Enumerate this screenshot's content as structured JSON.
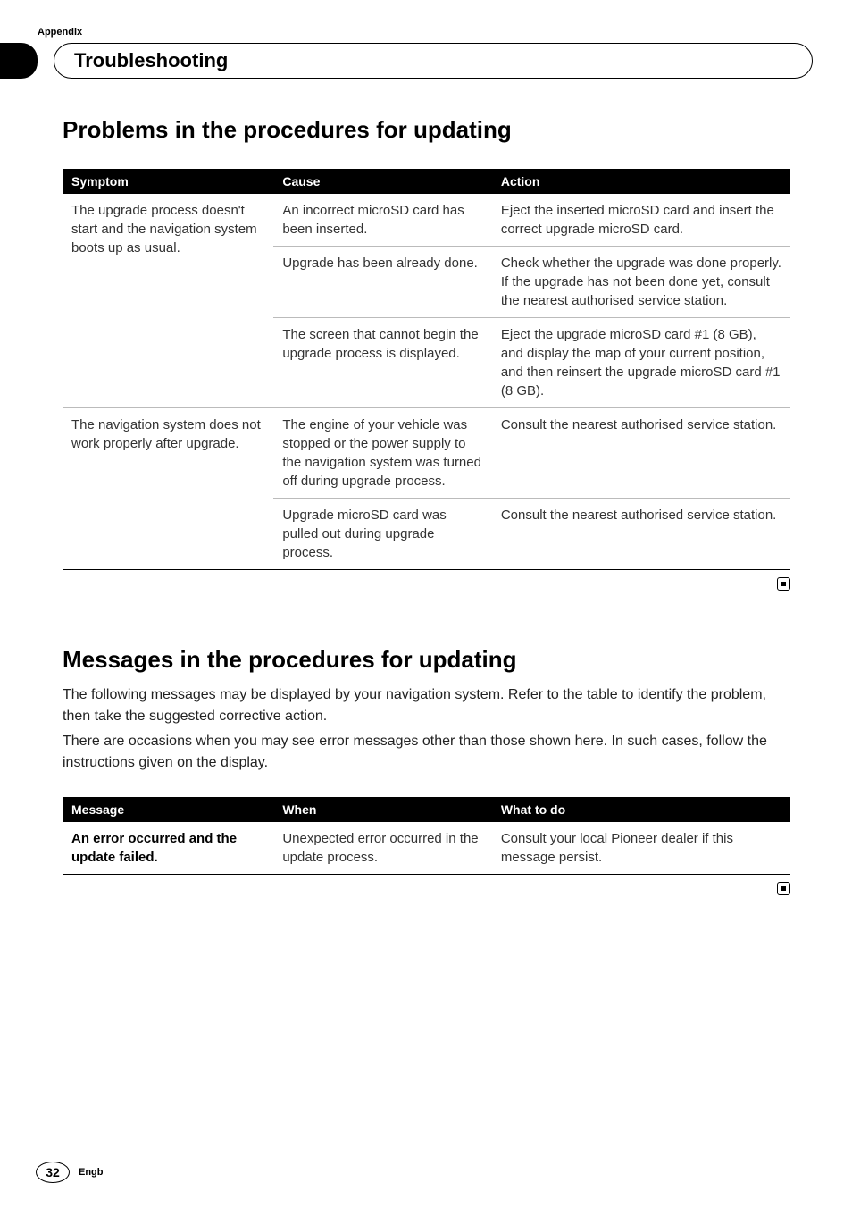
{
  "appendix_label": "Appendix",
  "page_title": "Troubleshooting",
  "section1": {
    "heading": "Problems in the procedures for updating",
    "table": {
      "headers": [
        "Symptom",
        "Cause",
        "Action"
      ],
      "rows": [
        {
          "symptom": "The upgrade process doesn't start and the navigation system boots up as usual.",
          "cause": "An incorrect microSD card has been inserted.",
          "action": "Eject the inserted microSD card and insert the correct upgrade microSD card."
        },
        {
          "symptom": "",
          "cause": "Upgrade has been already done.",
          "action": "Check whether the upgrade was done properly. If the upgrade has not been done yet, consult the nearest authorised service station."
        },
        {
          "symptom": "",
          "cause": "The screen that cannot begin the upgrade process is displayed.",
          "action": "Eject the upgrade microSD card #1 (8 GB), and display the map of your current position, and then reinsert the upgrade microSD card #1 (8 GB)."
        },
        {
          "symptom": "The navigation system does not work properly after upgrade.",
          "cause": "The engine of your vehicle was stopped or the power supply to the navigation system was turned off during upgrade process.",
          "action": "Consult the nearest authorised service station."
        },
        {
          "symptom": "",
          "cause": "Upgrade microSD card was pulled out during upgrade process.",
          "action": "Consult the nearest authorised service station."
        }
      ]
    }
  },
  "section2": {
    "heading": "Messages in the procedures for updating",
    "intro1": "The following messages may be displayed by your navigation system. Refer to the table to identify the problem, then take the suggested corrective action.",
    "intro2": "There are occasions when you may see error messages other than those shown here. In such cases, follow the instructions given on the display.",
    "table": {
      "headers": [
        "Message",
        "When",
        "What to do"
      ],
      "rows": [
        {
          "message": "An error occurred and the update failed.",
          "when": "Unexpected error occurred in the update process.",
          "what": "Consult your local Pioneer dealer if this message persist."
        }
      ]
    }
  },
  "footer": {
    "page_number": "32",
    "lang": "Engb"
  }
}
